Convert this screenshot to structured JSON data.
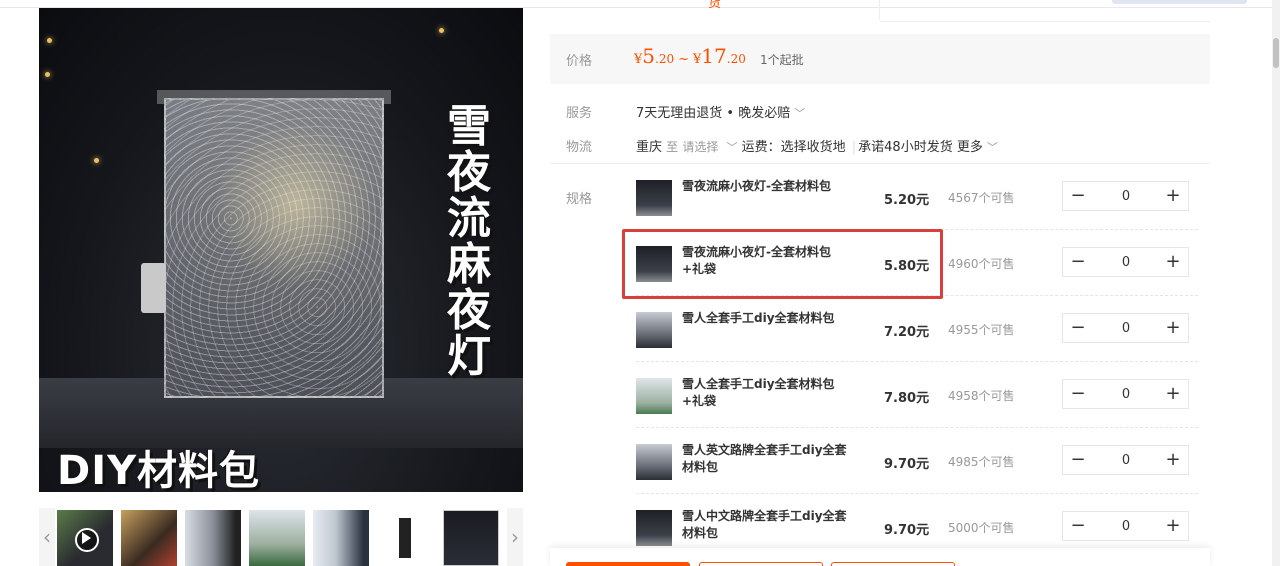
{
  "top": {
    "tab_partial": "货"
  },
  "main_image": {
    "vertical_title": [
      "雪",
      "夜",
      "流",
      "麻",
      "夜",
      "灯"
    ],
    "bottom_title": "DIY材料包"
  },
  "thumbnails": {
    "count": 7,
    "prev_icon": "chevron-left-icon",
    "next_icon": "chevron-right-icon"
  },
  "price": {
    "label": "价格",
    "currency": "¥",
    "min_int": "5",
    "min_dec": ".20",
    "tilde": "~",
    "max_int": "17",
    "max_dec": ".20",
    "moq": "1个起批",
    "color": "#ff5000"
  },
  "service": {
    "label": "服务",
    "value": "7天无理由退货 • 晚发必赔"
  },
  "logistics": {
    "label": "物流",
    "from": "重庆",
    "to_word": "至",
    "select": "请选择",
    "fee": "运费：选择收货地",
    "promise": "承诺48小时发货",
    "more": "更多"
  },
  "specs": {
    "label": "规格",
    "items": [
      {
        "name": "雪夜流麻小夜灯-全套材料包",
        "price": "5.20元",
        "stock": "4567个可售",
        "qty": "0"
      },
      {
        "name": "雪夜流麻小夜灯-全套材料包+礼袋",
        "price": "5.80元",
        "stock": "4960个可售",
        "qty": "0"
      },
      {
        "name": "雪人全套手工diy全套材料包",
        "price": "7.20元",
        "stock": "4955个可售",
        "qty": "0"
      },
      {
        "name": "雪人全套手工diy全套材料包+礼袋",
        "price": "7.80元",
        "stock": "4958个可售",
        "qty": "0"
      },
      {
        "name": "雪人英文路牌全套手工diy全套材料包",
        "price": "9.70元",
        "stock": "4985个可售",
        "qty": "0"
      },
      {
        "name": "雪人中文路牌全套手工diy全套材料包",
        "price": "9.70元",
        "stock": "5000个可售",
        "qty": "0"
      }
    ],
    "minus": "−",
    "plus": "+",
    "highlight_color": "#d9403a"
  }
}
